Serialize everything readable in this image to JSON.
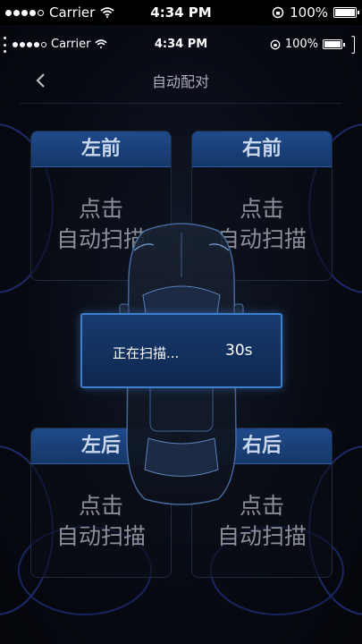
{
  "status": {
    "carrier": "Carrier",
    "time": "4:34 PM",
    "battery": "100%"
  },
  "inner_status": {
    "carrier": "Carrier",
    "time": "4:34 PM",
    "battery": "100%"
  },
  "nav": {
    "back_icon": "chevron-left-icon",
    "title": "自动配对"
  },
  "tires": [
    {
      "label": "左前",
      "line1": "点击",
      "line2": "自动扫描"
    },
    {
      "label": "右前",
      "line1": "点击",
      "line2": "自动扫描"
    },
    {
      "label": "左后",
      "line1": "点击",
      "line2": "自动扫描"
    },
    {
      "label": "右后",
      "line1": "点击",
      "line2": "自动扫描"
    }
  ],
  "dialog": {
    "message": "正在扫描...",
    "countdown": "30s"
  },
  "colors": {
    "card_header": "#1f4a8a",
    "dialog_border": "#3e7fd0",
    "dialog_bg": "#183b70"
  }
}
